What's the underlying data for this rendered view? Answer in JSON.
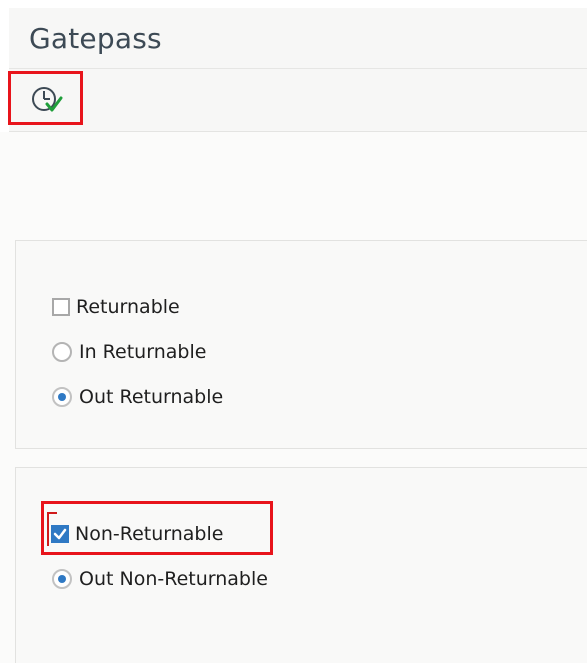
{
  "title": "Gatepass",
  "toolbar": {
    "execute_icon": "execute-clock-check-icon"
  },
  "options": {
    "returnable": {
      "label": "Returnable",
      "checked": false
    },
    "in_returnable": {
      "label": "In Returnable",
      "selected": false
    },
    "out_returnable": {
      "label": "Out Returnable",
      "selected": true
    },
    "non_returnable": {
      "label": "Non-Returnable",
      "checked": true
    },
    "out_non_returnable": {
      "label": "Out Non-Returnable",
      "selected": true
    }
  },
  "colors": {
    "highlight": "#e8141b",
    "accent": "#2f79c4",
    "check_green": "#1f9e3a"
  }
}
